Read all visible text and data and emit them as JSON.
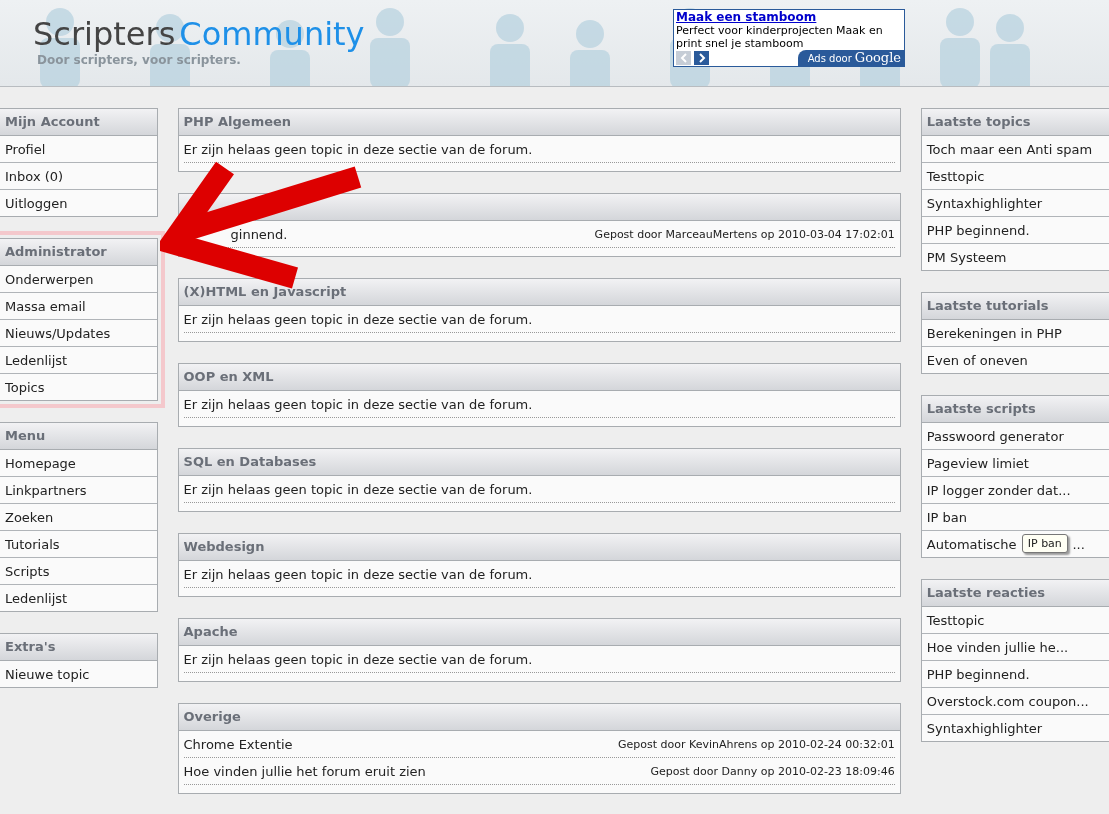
{
  "header": {
    "logo_dark": "Scripters",
    "logo_light": "Community",
    "slogan": "Door scripters, voor scripters.",
    "ad": {
      "title": "Maak een stamboom",
      "text": "Perfect voor kinderprojecten Maak en print snel je stamboom",
      "prev_disabled": true,
      "next_disabled": false,
      "badge": "Ads door",
      "brand": "Google"
    }
  },
  "left_boxes": [
    {
      "title": "Mijn Account",
      "highlighted": false,
      "items": [
        "Profiel",
        "Inbox (0)",
        "Uitloggen"
      ]
    },
    {
      "title": "Administrator",
      "highlighted": true,
      "items": [
        "Onderwerpen",
        "Massa email",
        "Nieuws/Updates",
        "Ledenlijst",
        "Topics"
      ]
    },
    {
      "title": "Menu",
      "highlighted": false,
      "items": [
        "Homepage",
        "Linkpartners",
        "Zoeken",
        "Tutorials",
        "Scripts",
        "Ledenlijst"
      ]
    },
    {
      "title": "Extra's",
      "highlighted": false,
      "items": [
        "Nieuwe topic"
      ]
    }
  ],
  "sections": [
    {
      "title": "PHP Algemeen",
      "obscured": false,
      "topics": [
        {
          "title": "Er zijn helaas geen topic in deze sectie van de forum."
        }
      ]
    },
    {
      "obscured": true,
      "topics": [
        {
          "title": "ginnend.",
          "meta": "Gepost door MarceauMertens op 2010-03-04 17:02:01"
        }
      ]
    },
    {
      "title": "(X)HTML en Javascript",
      "obscured": false,
      "topics": [
        {
          "title": "Er zijn helaas geen topic in deze sectie van de forum."
        }
      ]
    },
    {
      "title": "OOP en XML",
      "obscured": false,
      "topics": [
        {
          "title": "Er zijn helaas geen topic in deze sectie van de forum."
        }
      ]
    },
    {
      "title": "SQL en Databases",
      "obscured": false,
      "topics": [
        {
          "title": "Er zijn helaas geen topic in deze sectie van de forum."
        }
      ]
    },
    {
      "title": "Webdesign",
      "obscured": false,
      "topics": [
        {
          "title": "Er zijn helaas geen topic in deze sectie van de forum."
        }
      ]
    },
    {
      "title": "Apache",
      "obscured": false,
      "topics": [
        {
          "title": "Er zijn helaas geen topic in deze sectie van de forum."
        }
      ]
    },
    {
      "title": "Overige",
      "obscured": false,
      "topics": [
        {
          "title": "Chrome Extentie",
          "meta": "Gepost door KevinAhrens op 2010-02-24 00:32:01"
        },
        {
          "title": "Hoe vinden jullie het forum eruit zien",
          "meta": "Gepost door Danny op 2010-02-23 18:09:46"
        }
      ]
    }
  ],
  "right_boxes": [
    {
      "title": "Laatste topics",
      "items": [
        {
          "label": "Toch maar een Anti spam"
        },
        {
          "label": "Testtopic"
        },
        {
          "label": "Syntaxhighlighter"
        },
        {
          "label": "PHP beginnend."
        },
        {
          "label": "PM Systeem"
        }
      ]
    },
    {
      "title": "Laatste tutorials",
      "items": [
        {
          "label": "Berekeningen in PHP"
        },
        {
          "label": "Even of oneven"
        }
      ]
    },
    {
      "title": "Laatste scripts",
      "items": [
        {
          "label": "Passwoord generator"
        },
        {
          "label": "Pageview limiet"
        },
        {
          "label": "IP logger zonder dat..."
        },
        {
          "label": "IP ban"
        },
        {
          "label": "Automatische",
          "tooltip": "IP ban",
          "tail": "..."
        }
      ]
    },
    {
      "title": "Laatste reacties",
      "items": [
        {
          "label": "Testtopic"
        },
        {
          "label": "Hoe vinden jullie he..."
        },
        {
          "label": "PHP beginnend."
        },
        {
          "label": "Overstock.com coupon..."
        },
        {
          "label": "Syntaxhighlighter"
        }
      ]
    }
  ]
}
